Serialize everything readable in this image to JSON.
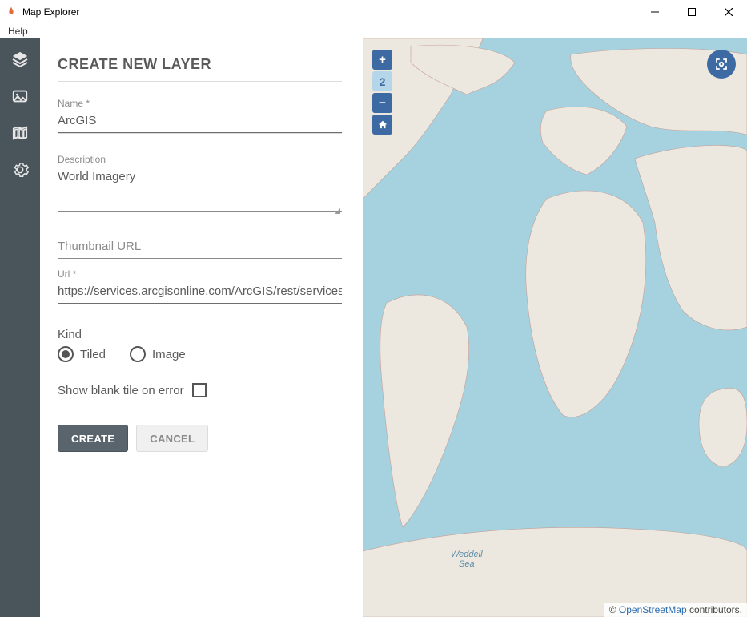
{
  "window": {
    "title": "Map Explorer"
  },
  "menu": {
    "help": "Help"
  },
  "panel": {
    "title": "CREATE NEW LAYER",
    "name_label": "Name *",
    "name_value": "ArcGIS",
    "desc_label": "Description",
    "desc_value": "World Imagery",
    "thumb_placeholder": "Thumbnail URL",
    "url_label": "Url *",
    "url_value": "https://services.arcgisonline.com/ArcGIS/rest/services/W",
    "kind_label": "Kind",
    "kind_options": {
      "tiled": "Tiled",
      "image": "Image"
    },
    "kind_selected": "tiled",
    "blank_tile_label": "Show blank tile on error",
    "blank_tile_checked": false,
    "create_btn": "CREATE",
    "cancel_btn": "CANCEL"
  },
  "sidebar": {
    "items": [
      {
        "id": "layers",
        "icon": "layers-icon"
      },
      {
        "id": "image",
        "icon": "image-icon"
      },
      {
        "id": "map",
        "icon": "map-icon"
      },
      {
        "id": "settings",
        "icon": "gear-icon"
      }
    ]
  },
  "map": {
    "zoom_level": "2",
    "sea_label": "Weddell\nSea",
    "attribution_prefix": "© ",
    "attribution_link": "OpenStreetMap",
    "attribution_suffix": " contributors."
  }
}
